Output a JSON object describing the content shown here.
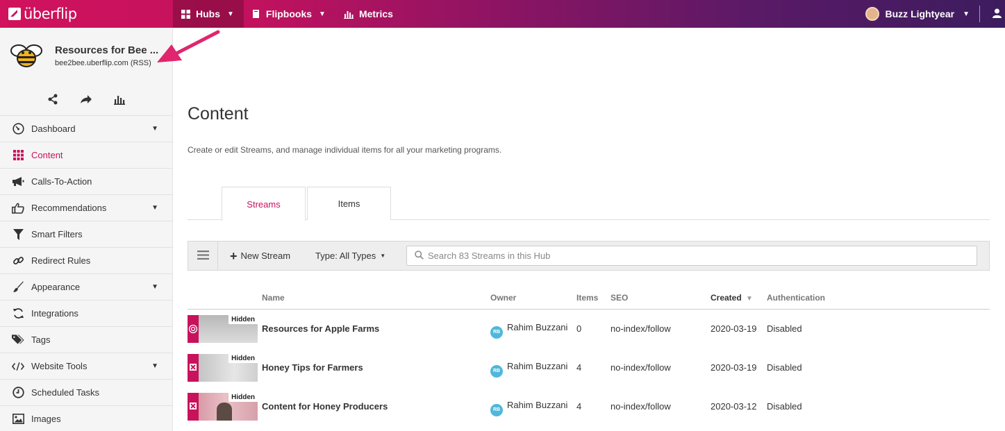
{
  "topbar": {
    "logo_text": "überflip",
    "nav": [
      {
        "label": "Hubs"
      },
      {
        "label": "Flipbooks"
      },
      {
        "label": "Metrics"
      }
    ],
    "user_name": "Buzz Lightyear"
  },
  "sidebar": {
    "hub_name": "Resources for Bee ...",
    "hub_domain": "bee2bee.uberflip.com (RSS)",
    "items": [
      {
        "label": "Dashboard",
        "icon": "gauge-icon",
        "expandable": true
      },
      {
        "label": "Content",
        "icon": "grid-icon",
        "active": true
      },
      {
        "label": "Calls-To-Action",
        "icon": "megaphone-icon"
      },
      {
        "label": "Recommendations",
        "icon": "thumbs-up-icon",
        "expandable": true
      },
      {
        "label": "Smart Filters",
        "icon": "filter-icon"
      },
      {
        "label": "Redirect Rules",
        "icon": "link-icon"
      },
      {
        "label": "Appearance",
        "icon": "brush-icon",
        "expandable": true
      },
      {
        "label": "Integrations",
        "icon": "sync-icon"
      },
      {
        "label": "Tags",
        "icon": "tags-icon"
      },
      {
        "label": "Website Tools",
        "icon": "code-icon",
        "expandable": true
      },
      {
        "label": "Scheduled Tasks",
        "icon": "clock-icon"
      },
      {
        "label": "Images",
        "icon": "image-icon"
      }
    ]
  },
  "main": {
    "title": "Content",
    "description": "Create or edit Streams, and manage individual items for all your marketing programs.",
    "tabs": [
      {
        "label": "Streams",
        "active": true
      },
      {
        "label": "Items"
      }
    ],
    "toolbar": {
      "new_stream": "New Stream",
      "type_filter": "Type: All Types",
      "search_placeholder": "Search 83 Streams in this Hub"
    },
    "table": {
      "headers": {
        "name": "Name",
        "owner": "Owner",
        "items": "Items",
        "seo": "SEO",
        "created": "Created",
        "authentication": "Authentication"
      },
      "rows": [
        {
          "badge": "Hidden",
          "name": "Resources for Apple Farms",
          "owner_initials": "RB",
          "owner": "Rahim Buzzani",
          "items": "0",
          "seo": "no-index/follow",
          "created": "2020-03-19",
          "authentication": "Disabled"
        },
        {
          "badge": "Hidden",
          "name": "Honey Tips for Farmers",
          "owner_initials": "RB",
          "owner": "Rahim Buzzani",
          "items": "4",
          "seo": "no-index/follow",
          "created": "2020-03-19",
          "authentication": "Disabled"
        },
        {
          "badge": "Hidden",
          "name": "Content for Honey Producers",
          "owner_initials": "RB",
          "owner": "Rahim Buzzani",
          "items": "4",
          "seo": "no-index/follow",
          "created": "2020-03-12",
          "authentication": "Disabled"
        }
      ]
    }
  },
  "colors": {
    "brand": "#c8125c",
    "owner_badge": "#4fb8da"
  }
}
